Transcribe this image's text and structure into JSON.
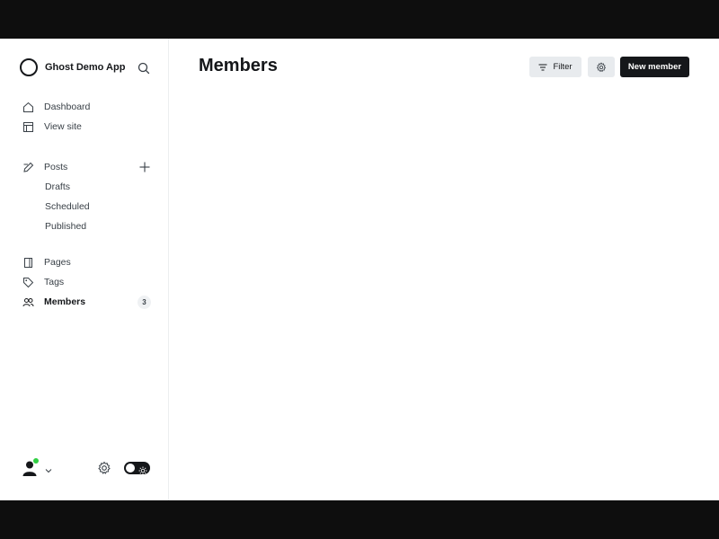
{
  "brand": {
    "name": "Ghost Demo App"
  },
  "nav": {
    "dashboard": "Dashboard",
    "view_site": "View site",
    "posts": "Posts",
    "drafts": "Drafts",
    "scheduled": "Scheduled",
    "published": "Published",
    "pages": "Pages",
    "tags": "Tags",
    "members": "Members",
    "members_count": "3"
  },
  "header": {
    "title": "Members",
    "filter_label": "Filter",
    "new_member_label": "New member"
  },
  "colors": {
    "accent": "#15171a",
    "online": "#30cf43",
    "button_bg": "#e8ebee"
  }
}
